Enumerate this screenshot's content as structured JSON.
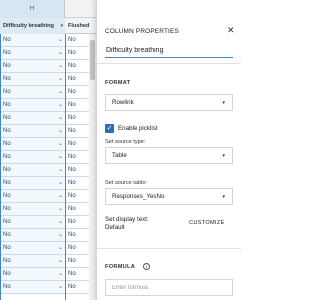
{
  "grid": {
    "column_letter": "H",
    "columns": [
      {
        "label": "Difficulty breathing"
      },
      {
        "label": "Flushed"
      }
    ],
    "rows": [
      {
        "h": "No",
        "i": "No"
      },
      {
        "h": "No",
        "i": "No"
      },
      {
        "h": "No",
        "i": "No"
      },
      {
        "h": "No",
        "i": "No"
      },
      {
        "h": "No",
        "i": "No"
      },
      {
        "h": "No",
        "i": "No"
      },
      {
        "h": "No",
        "i": "No"
      },
      {
        "h": "No",
        "i": "No"
      },
      {
        "h": "No",
        "i": "No"
      },
      {
        "h": "No",
        "i": "No"
      },
      {
        "h": "No",
        "i": "No"
      },
      {
        "h": "No",
        "i": "No"
      },
      {
        "h": "No",
        "i": "No"
      },
      {
        "h": "No",
        "i": "No"
      },
      {
        "h": "No",
        "i": "No"
      },
      {
        "h": "No",
        "i": "No"
      },
      {
        "h": "No",
        "i": "No"
      },
      {
        "h": "No",
        "i": "No"
      },
      {
        "h": "No",
        "i": "No"
      },
      {
        "h": "No",
        "i": "No"
      }
    ]
  },
  "panel": {
    "title": "COLUMN PROPERTIES",
    "column_name": "Difficulty breathing",
    "format": {
      "label": "FORMAT",
      "value": "Rowlink"
    },
    "picklist": {
      "label": "Enable picklist",
      "checked": true
    },
    "source_type": {
      "label": "Set source type:",
      "value": "Table"
    },
    "source_table": {
      "label": "Set source table:",
      "value": "Responses_YesNo"
    },
    "display_text": {
      "label": "Set display text:",
      "value": "Default",
      "customize_label": "CUSTOMIZE"
    },
    "formula": {
      "label": "FORMULA",
      "placeholder": "Enter formula",
      "value": ""
    }
  },
  "icons": {
    "close": "close-icon",
    "caret": "caret-down-icon",
    "chevron": "chevron-down-icon",
    "check": "checkmark-icon",
    "info": "info-icon"
  },
  "colors": {
    "accent": "#3e86c7",
    "checkbox": "#2f6db3",
    "cell_text": "#1a4d80"
  }
}
